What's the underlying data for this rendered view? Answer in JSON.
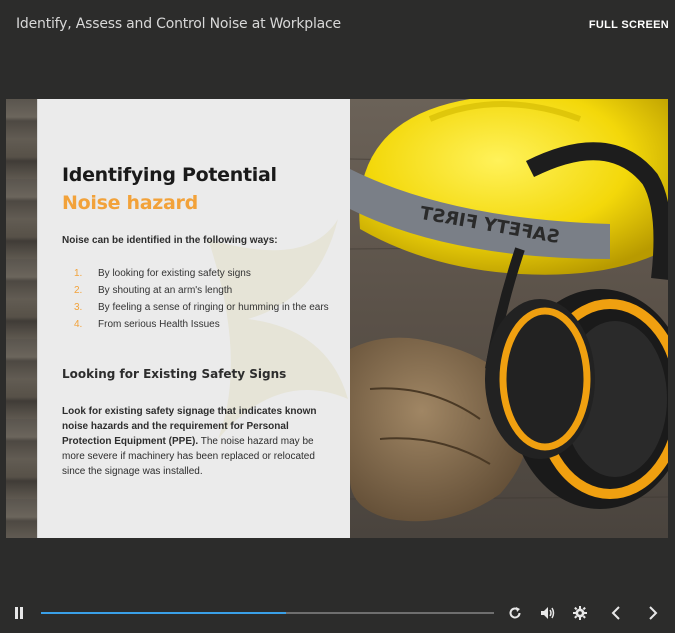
{
  "header": {
    "course_title": "Identify, Assess and Control Noise at Workplace",
    "fullscreen_label": "FULL SCREEN"
  },
  "slide": {
    "heading_line1": "Identifying Potential",
    "heading_line2": "Noise hazard",
    "intro": "Noise can be identified in the following ways:",
    "ways": [
      {
        "num": "1.",
        "text": "By looking for existing safety signs"
      },
      {
        "num": "2.",
        "text": "By shouting at an arm's length"
      },
      {
        "num": "3.",
        "text": "By feeling a sense of ringing or humming in the ears"
      },
      {
        "num": "4.",
        "text": "From serious Health Issues"
      }
    ],
    "subheading": "Looking for Existing Safety Signs",
    "paragraph_bold": "Look for existing safety signage that indicates known noise hazards and the requirement for Personal Protection Equipment (PPE).",
    "paragraph_rest": " The noise hazard may be more severe if machinery has been replaced or relocated since the signage was installed.",
    "image_icons": [
      "hard-hat",
      "earmuffs",
      "leather-gloves"
    ],
    "helmet_band_text": "SAFETY FIRST"
  },
  "player": {
    "progress": 0.54,
    "controls": [
      "pause-icon",
      "replay-icon",
      "volume-icon",
      "gear-icon",
      "chevron-left-icon",
      "chevron-right-icon"
    ]
  },
  "colors": {
    "accent_orange": "#f2a23a",
    "progress_blue": "#3aa0e8",
    "background": "#2c2c2b"
  }
}
